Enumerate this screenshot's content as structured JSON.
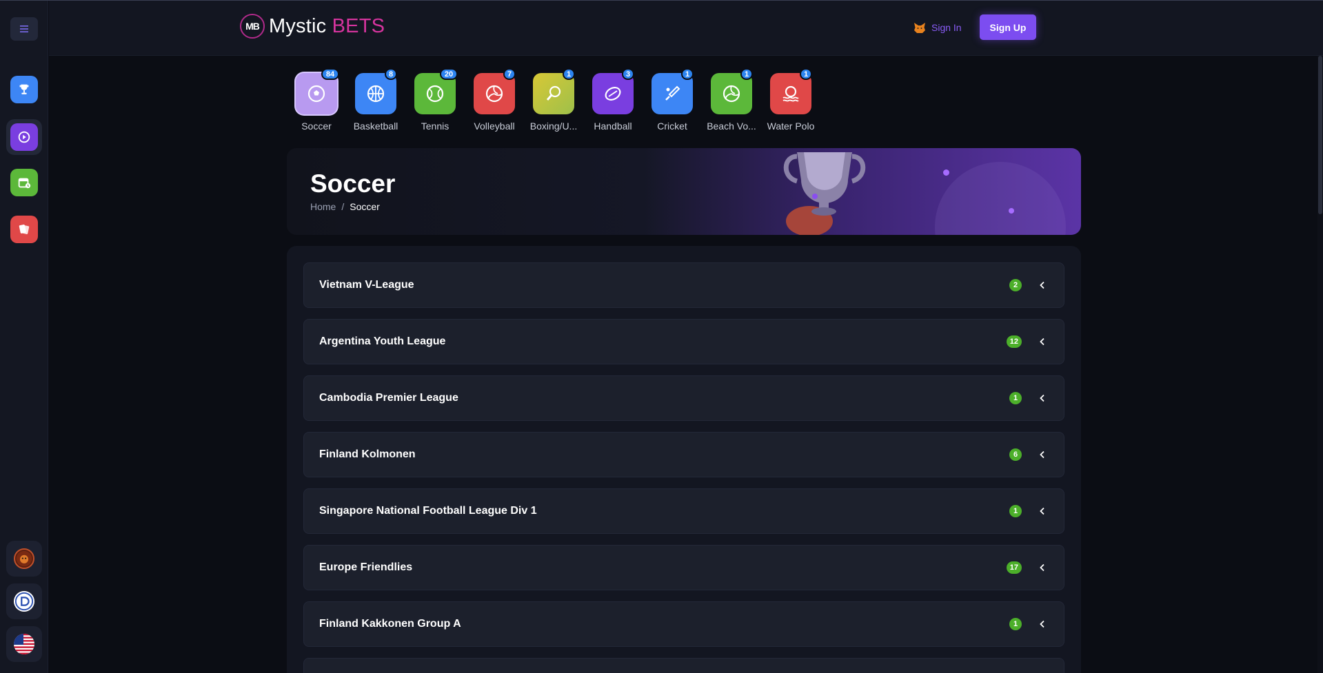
{
  "header": {
    "logo_mark": "MB",
    "logo_text_main": "Mystic",
    "logo_text_accent": "BETS",
    "sign_in": "Sign In",
    "sign_up": "Sign Up"
  },
  "sidebar": {
    "apps": [
      {
        "icon": "trophy-icon",
        "color": "#3d86f5"
      },
      {
        "icon": "live-play-icon",
        "color": "#7a3ee0"
      },
      {
        "icon": "calendar-icon",
        "color": "#5cb83a"
      },
      {
        "icon": "cards-icon",
        "color": "#e04848"
      }
    ],
    "bottom": [
      {
        "icon": "tiger-avatar-icon"
      },
      {
        "icon": "crypto-coin-icon"
      },
      {
        "icon": "us-flag-icon"
      }
    ]
  },
  "sports": [
    {
      "label": "Soccer",
      "count": "84",
      "color": "#b89af0",
      "icon": "soccer-ball-icon"
    },
    {
      "label": "Basketball",
      "count": "8",
      "color": "#3d86f5",
      "icon": "basketball-icon"
    },
    {
      "label": "Tennis",
      "count": "20",
      "color": "#5cb83a",
      "icon": "tennis-ball-icon"
    },
    {
      "label": "Volleyball",
      "count": "7",
      "color": "#e04848",
      "icon": "volleyball-icon"
    },
    {
      "label": "Boxing/U...",
      "count": "1",
      "color": "#c8c040",
      "icon": "boxing-glove-icon"
    },
    {
      "label": "Handball",
      "count": "3",
      "color": "#7a3ee0",
      "icon": "handball-icon"
    },
    {
      "label": "Cricket",
      "count": "1",
      "color": "#3d86f5",
      "icon": "cricket-bat-icon"
    },
    {
      "label": "Beach Vo...",
      "count": "1",
      "color": "#5cb83a",
      "icon": "beach-volleyball-icon"
    },
    {
      "label": "Water Polo",
      "count": "1",
      "color": "#e04848",
      "icon": "water-polo-icon"
    }
  ],
  "banner": {
    "title": "Soccer",
    "breadcrumb_home": "Home",
    "breadcrumb_sep": "/",
    "breadcrumb_current": "Soccer"
  },
  "leagues": [
    {
      "name": "Vietnam V-League",
      "count": "2"
    },
    {
      "name": "Argentina Youth League",
      "count": "12"
    },
    {
      "name": "Cambodia Premier League",
      "count": "1"
    },
    {
      "name": "Finland Kolmonen",
      "count": "6"
    },
    {
      "name": "Singapore National Football League Div 1",
      "count": "1"
    },
    {
      "name": "Europe Friendlies",
      "count": "17"
    },
    {
      "name": "Finland Kakkonen Group A",
      "count": "1"
    }
  ]
}
